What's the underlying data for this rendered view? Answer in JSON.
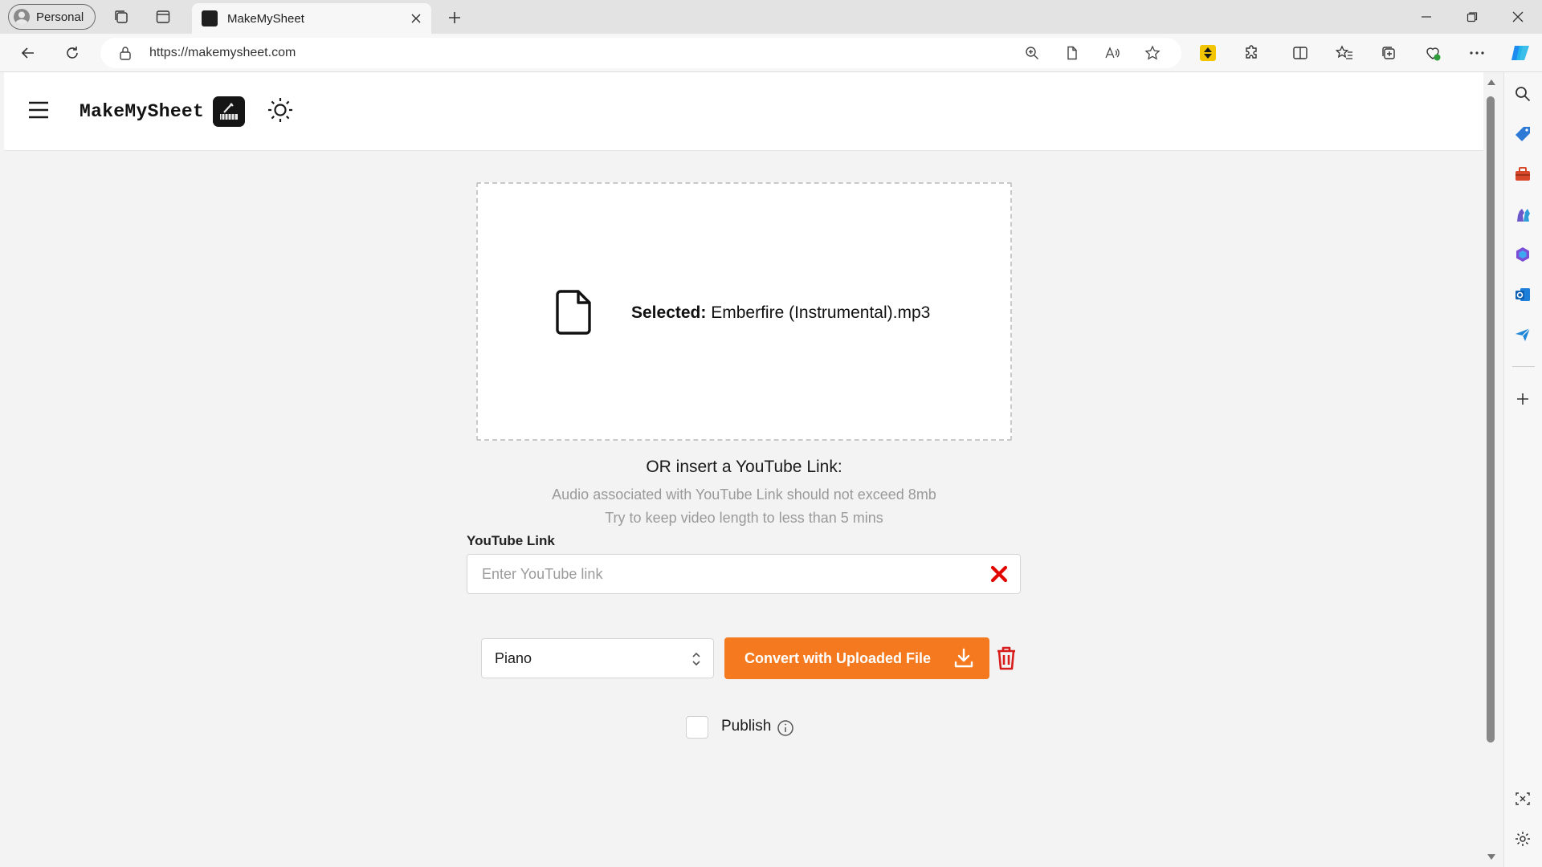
{
  "browser": {
    "profile_label": "Personal",
    "tab_title": "MakeMySheet",
    "url": "https://makemysheet.com"
  },
  "app": {
    "brand": "MakeMySheet",
    "accent_color": "#f57a1f",
    "danger_color": "#e10600"
  },
  "upload": {
    "selected_label": "Selected:",
    "selected_file": "Emberfire (Instrumental).mp3"
  },
  "youtube": {
    "or_title": "OR insert a YouTube Link:",
    "hint_size": "Audio associated with YouTube Link should not exceed 8mb",
    "hint_length": "Try to keep video length to less than 5 mins",
    "label": "YouTube Link",
    "placeholder": "Enter YouTube link",
    "value": ""
  },
  "controls": {
    "instrument_selected": "Piano",
    "convert_label": "Convert with Uploaded File",
    "publish_label": "Publish",
    "publish_checked": false
  }
}
